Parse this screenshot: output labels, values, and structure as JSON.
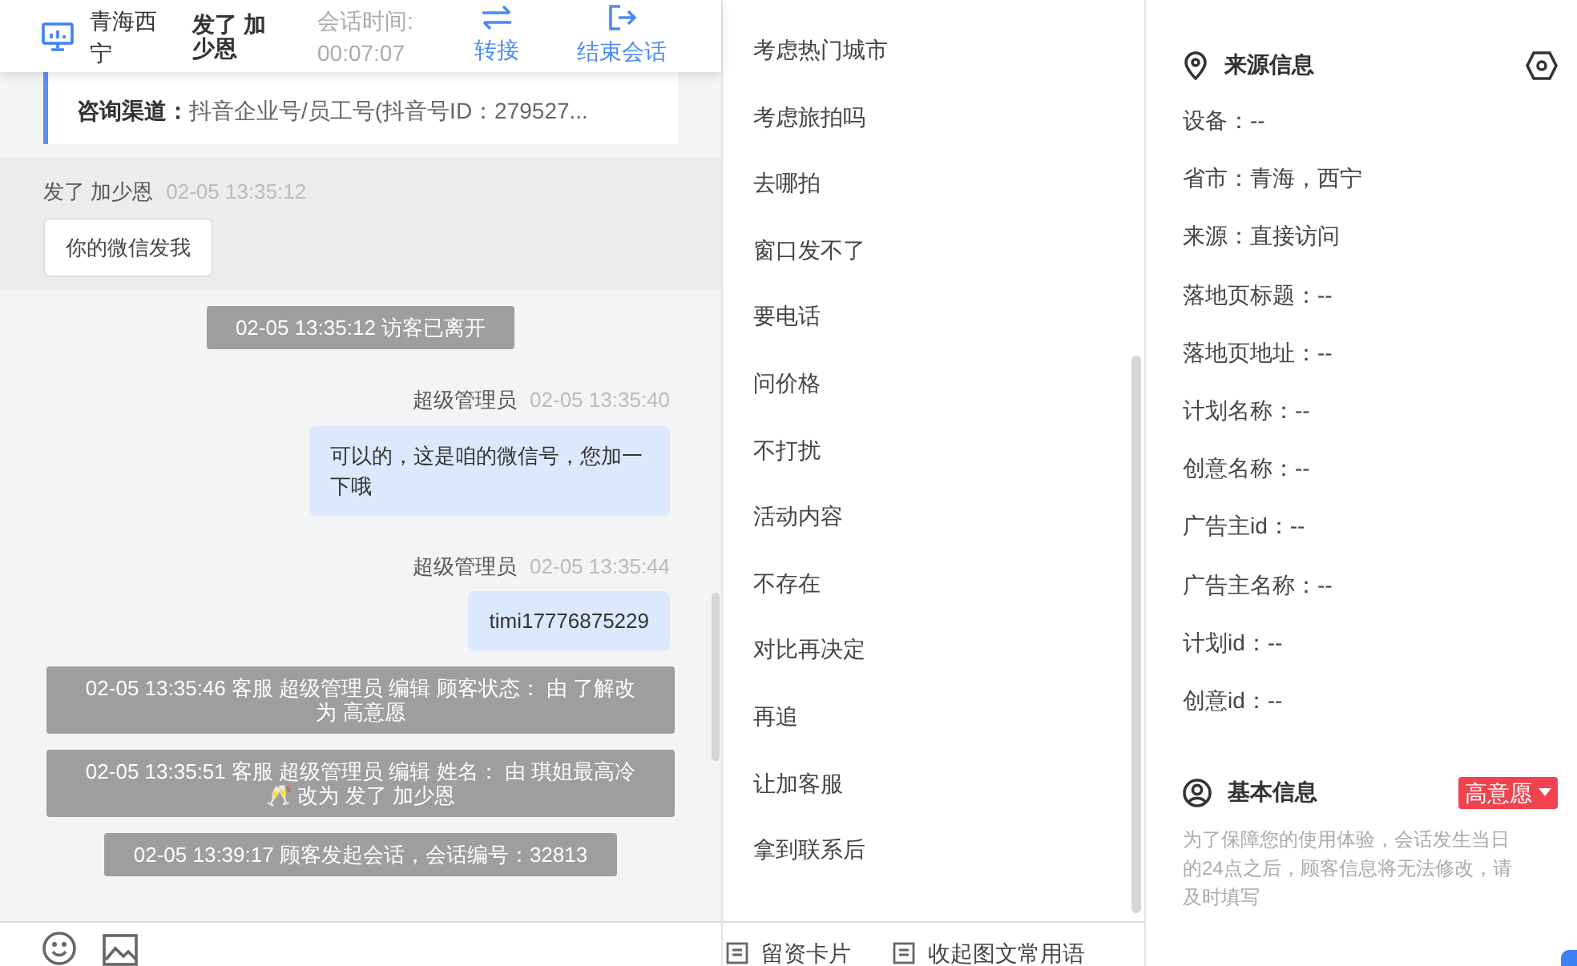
{
  "header": {
    "location": "青海西宁",
    "visitor_name": "发了 加少恩",
    "duration_label": "会话时间:",
    "duration": "00:07:07",
    "actions": [
      {
        "kind": "transfer",
        "label": "转接"
      },
      {
        "kind": "end",
        "label": "结束会话"
      }
    ]
  },
  "info_card": {
    "label": "咨询渠道：",
    "value": "抖音企业号/员工号(抖音号ID：279527..."
  },
  "messages": [
    {
      "kind": "visitor",
      "sender": "发了 加少恩",
      "time": "02-05 13:35:12",
      "text": "你的微信发我"
    },
    {
      "kind": "notice",
      "text": "02-05 13:35:12 访客已离开"
    },
    {
      "kind": "agent",
      "sender": "超级管理员",
      "time": "02-05 13:35:40",
      "text": "可以的，这是咱的微信号，您加一下哦"
    },
    {
      "kind": "agent",
      "sender": "超级管理员",
      "time": "02-05 13:35:44",
      "text": "timi17776875229"
    },
    {
      "kind": "notice",
      "text": "02-05 13:35:46 客服 超级管理员 编辑 顾客状态： 由 了解改为 高意愿"
    },
    {
      "kind": "notice",
      "text": "02-05 13:35:51 客服 超级管理员 编辑 姓名： 由 琪姐最高冷🥂 改为 发了 加少恩"
    },
    {
      "kind": "notice",
      "text": "02-05 13:39:17 顾客发起会话，会话编号：32813"
    }
  ],
  "quick_replies": [
    "考虑热门城市",
    "考虑旅拍吗",
    "去哪拍",
    "窗口发不了",
    "要电话",
    "问价格",
    "不打扰",
    "活动内容",
    "不存在",
    "对比再决定",
    "再追",
    "让加客服",
    "拿到联系后"
  ],
  "bottom_actions": [
    "留资卡片",
    "收起图文常用语"
  ],
  "source_info": {
    "title": "来源信息",
    "rows": [
      "设备：--",
      "省市：青海，西宁",
      "来源：直接访问",
      "落地页标题：--",
      "落地页地址：--",
      "计划名称：--",
      "创意名称：--",
      "广告主id：--",
      "广告主名称：--",
      "计划id：--",
      "创意id：--"
    ]
  },
  "basic_info": {
    "title": "基本信息",
    "status": "高意愿",
    "note": "为了保障您的使用体验，会话发生当日的24点之后，顾客信息将无法修改，请及时填写"
  }
}
